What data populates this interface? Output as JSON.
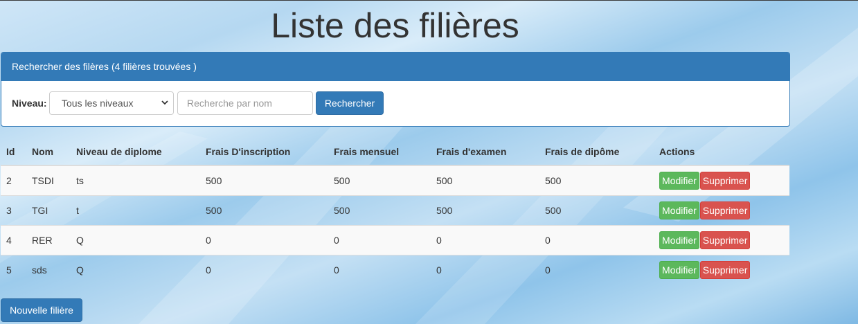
{
  "page": {
    "title": "Liste des filières"
  },
  "search": {
    "heading": "Rechercher des filères (4 filières trouvées )",
    "niveau_label": "Niveau:",
    "niveau_selected": "Tous les niveaux",
    "name_placeholder": "Recherche par nom",
    "submit_label": "Rechercher"
  },
  "table": {
    "headers": [
      "Id",
      "Nom",
      "Niveau de diplome",
      "Frais D'inscription",
      "Frais mensuel",
      "Frais d'examen",
      "Frais de dipôme",
      "Actions"
    ],
    "rows": [
      [
        "2",
        "TSDI",
        "ts",
        "500",
        "500",
        "500",
        "500"
      ],
      [
        "3",
        "TGI",
        "t",
        "500",
        "500",
        "500",
        "500"
      ],
      [
        "4",
        "RER",
        "Q",
        "0",
        "0",
        "0",
        "0"
      ],
      [
        "5",
        "sds",
        "Q",
        "0",
        "0",
        "0",
        "0"
      ]
    ],
    "modify_label": "Modifier",
    "delete_label": "Supprimer"
  },
  "actions": {
    "new_label": "Nouvelle filière"
  },
  "colors": {
    "primary": "#337ab7",
    "success": "#5cb85c",
    "danger": "#d9534f"
  }
}
